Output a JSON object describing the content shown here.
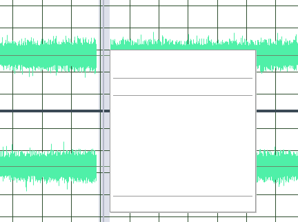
{
  "colors": {
    "background": "#ffffff",
    "grid": "#2f4f2f",
    "waveform": "#4ff0a8",
    "centerline": "#6a8a6a",
    "channel_divider": "#3c4a55",
    "selection": "#dde0ea",
    "cursor": "#b4b8c8"
  },
  "channels": [
    {
      "name": "waveform-channel-top"
    },
    {
      "name": "waveform-channel-bottom"
    }
  ],
  "context_menu": {
    "separator_count": 3
  }
}
